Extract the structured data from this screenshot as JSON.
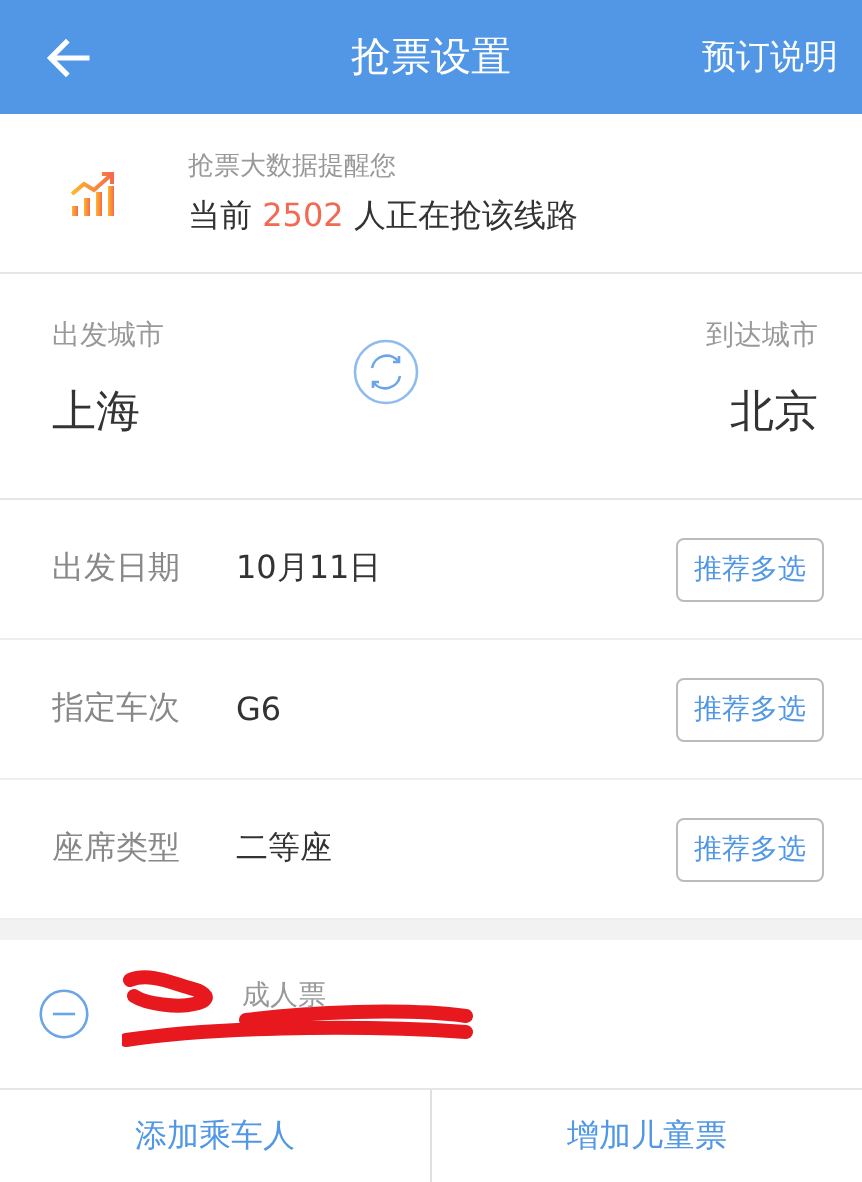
{
  "header": {
    "title": "抢票设置",
    "action": "预订说明"
  },
  "reminder": {
    "caption": "抢票大数据提醒您",
    "prefix": "当前",
    "count": "2502",
    "suffix": "人正在抢该线路"
  },
  "route": {
    "from_label": "出发城市",
    "from_city": "上海",
    "to_label": "到达城市",
    "to_city": "北京"
  },
  "settings": [
    {
      "label": "出发日期",
      "value": "10月11日",
      "button": "推荐多选"
    },
    {
      "label": "指定车次",
      "value": "G6",
      "button": "推荐多选"
    },
    {
      "label": "座席类型",
      "value": "二等座",
      "button": "推荐多选"
    }
  ],
  "passengers": [
    {
      "ticket_type": "成人票"
    }
  ],
  "footer": {
    "buttons": [
      "添加乘车人",
      "增加儿童票"
    ]
  }
}
